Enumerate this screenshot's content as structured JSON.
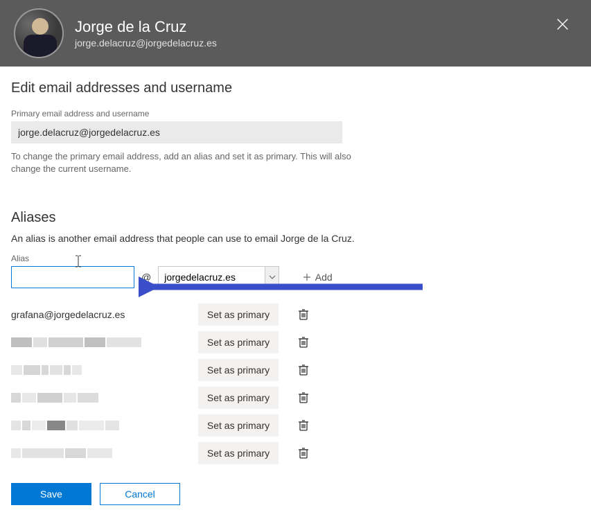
{
  "header": {
    "name": "Jorge de la Cruz",
    "email": "jorge.delacruz@jorgedelacruz.es"
  },
  "page": {
    "title": "Edit email addresses and username",
    "primary_label": "Primary email address and username",
    "primary_value": "jorge.delacruz@jorgedelacruz.es",
    "primary_help": "To change the primary email address, add an alias and set it as primary. This will also change the current username."
  },
  "aliases": {
    "section_title": "Aliases",
    "description": "An alias is another email address that people can use to email Jorge de la Cruz.",
    "input_label": "Alias",
    "at": "@",
    "domain": "jorgedelacruz.es",
    "add_label": "Add",
    "first_alias": "grafana@jorgedelacruz.es",
    "set_primary_label": "Set as primary"
  },
  "footer": {
    "save": "Save",
    "cancel": "Cancel"
  }
}
